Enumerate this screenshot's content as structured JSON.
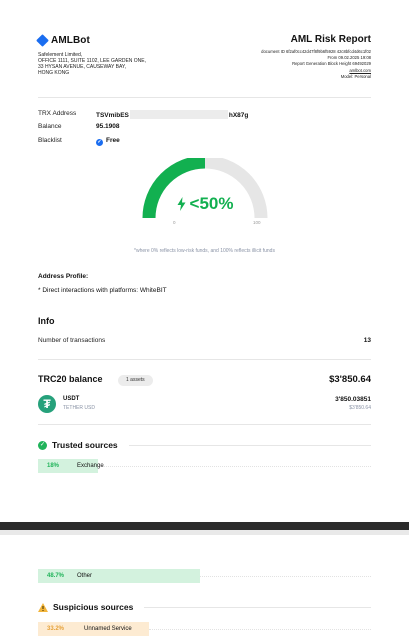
{
  "brand": {
    "name": "AMLBot"
  },
  "company": {
    "lines": [
      "Safelement Limited,",
      "OFFICE 1111, SUITE 1102, LEE GARDEN ONE,",
      "33 HYSAN AVENUE, CAUSEWAY BAY,",
      "HONG KONG"
    ]
  },
  "report": {
    "title": "AML Risk Report",
    "document_id": "document ID 6f2af0cc42d47f8f9b6f5928 42c8bfcd4d6c1f02",
    "from": "From 09.02.2025 19:08",
    "block_height": "Report Generation Block Height 69492029",
    "site": "amlbot.com",
    "model": "Model: Personal"
  },
  "address": {
    "trx_label": "TRX Address",
    "trx_prefix": "TSVmibES",
    "trx_suffix": "hX87g",
    "balance_label": "Balance",
    "balance_value": "95.1908",
    "blacklist_label": "Blacklist",
    "blacklist_value": "Free"
  },
  "risk": {
    "score_text": "<50%",
    "score_percent": 50,
    "min_label": "0",
    "max_label": "100",
    "note": "*where 0% reflects low-risk funds, and 100% reflects illicit funds",
    "color": "#12b050"
  },
  "profile": {
    "title": "Address Profile:",
    "item": "* Direct interactions with platforms: WhiteBIT"
  },
  "info": {
    "title": "Info",
    "tx_label": "Number of transactions",
    "tx_value": "13"
  },
  "trc20": {
    "title": "TRC20 balance",
    "assets_badge": "1 assets",
    "total": "$3'850.64",
    "token": {
      "symbol": "USDT",
      "name": "TETHER USD",
      "amount": "3'850.03851",
      "usd": "$3'850.64",
      "icon": "tether-icon",
      "icon_glyph": "₮"
    }
  },
  "trusted": {
    "title": "Trusted sources",
    "color": "#20b35a",
    "rows": [
      {
        "pct": "18%",
        "label": "Exchange",
        "fraction": 0.18
      }
    ]
  },
  "page2": {
    "other_row": {
      "pct": "48.7%",
      "label": "Other",
      "fraction": 0.487
    },
    "suspicious": {
      "title": "Suspicious sources",
      "color": "#f2b53b",
      "rows": [
        {
          "pct": "33.2%",
          "label": "Unnamed Service",
          "fraction": 0.332
        }
      ]
    }
  }
}
